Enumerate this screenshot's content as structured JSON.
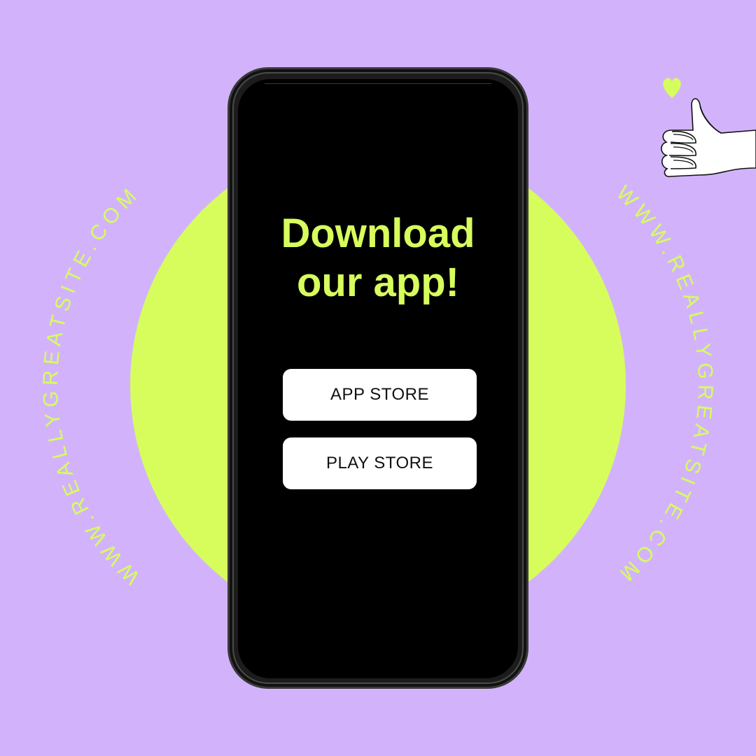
{
  "colors": {
    "background": "#d2b3fb",
    "accent": "#d7fd5d",
    "screen": "#000000",
    "button_bg": "#ffffff",
    "button_text": "#111111",
    "hand": "#ffffff"
  },
  "headline": {
    "line1": "Download",
    "line2": "our app!"
  },
  "buttons": {
    "app_store": "APP STORE",
    "play_store": "PLAY STORE"
  },
  "website": {
    "left_text": "WWW.REALLYGREATSITE.COM",
    "right_text": "WWW.REALLYGREATSITE.COM"
  },
  "icons": {
    "heart": "heart-icon",
    "thumbs_up": "thumbs-up-icon"
  }
}
